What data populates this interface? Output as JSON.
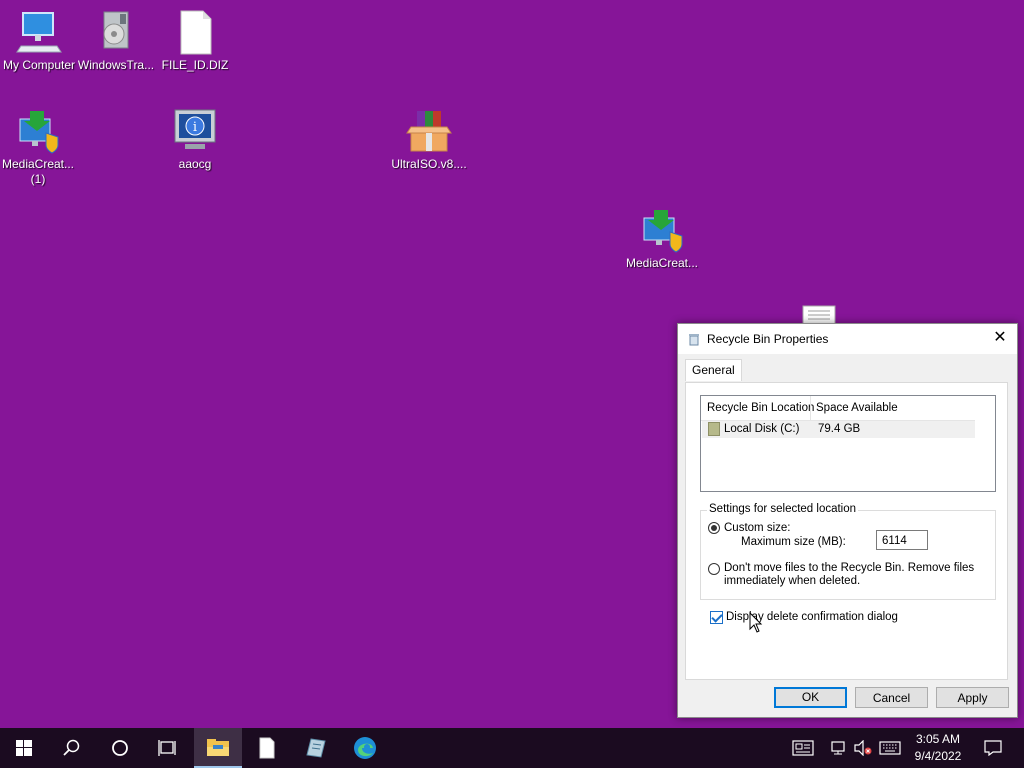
{
  "desktop": {
    "icons": [
      {
        "label": "My Computer",
        "icon": "computer-icon"
      },
      {
        "label": "WindowsTra...",
        "icon": "installer-icon"
      },
      {
        "label": "FILE_ID.DIZ",
        "icon": "file-icon"
      },
      {
        "label": "MediaCreat...",
        "label2": "(1)",
        "icon": "media-creation-tool-icon"
      },
      {
        "label": "aaocg",
        "icon": "info-monitor-icon"
      },
      {
        "label": "UltraISO.v8....",
        "icon": "rar-archive-icon"
      },
      {
        "label": "MediaCreat...",
        "icon": "media-creation-tool-icon"
      },
      {
        "label": "",
        "icon": "document-icon"
      }
    ]
  },
  "dialog": {
    "title": "Recycle Bin Properties",
    "close": "✕",
    "tab": "General",
    "list": {
      "col1": "Recycle Bin Location",
      "col2": "Space Available",
      "rows": [
        {
          "location": "Local Disk (C:)",
          "space": "79.4 GB"
        }
      ]
    },
    "settings": {
      "group_label": "Settings for selected location",
      "custom_size": "Custom size:",
      "max_size_label": "Maximum size (MB):",
      "max_size_value": "6114",
      "dont_move_line1": "Don't move files to the Recycle Bin. Remove files",
      "dont_move_line2": "immediately when deleted.",
      "selected_option": "custom"
    },
    "confirm_checkbox": {
      "label": "Display delete confirmation dialog",
      "checked": true
    },
    "buttons": {
      "ok": "OK",
      "cancel": "Cancel",
      "apply": "Apply"
    }
  },
  "taskbar": {
    "time": "3:05 AM",
    "date": "9/4/2022",
    "accent": "#9fc7ec"
  },
  "colors": {
    "desktop": "#861598",
    "taskbar": "#1b0b20"
  }
}
